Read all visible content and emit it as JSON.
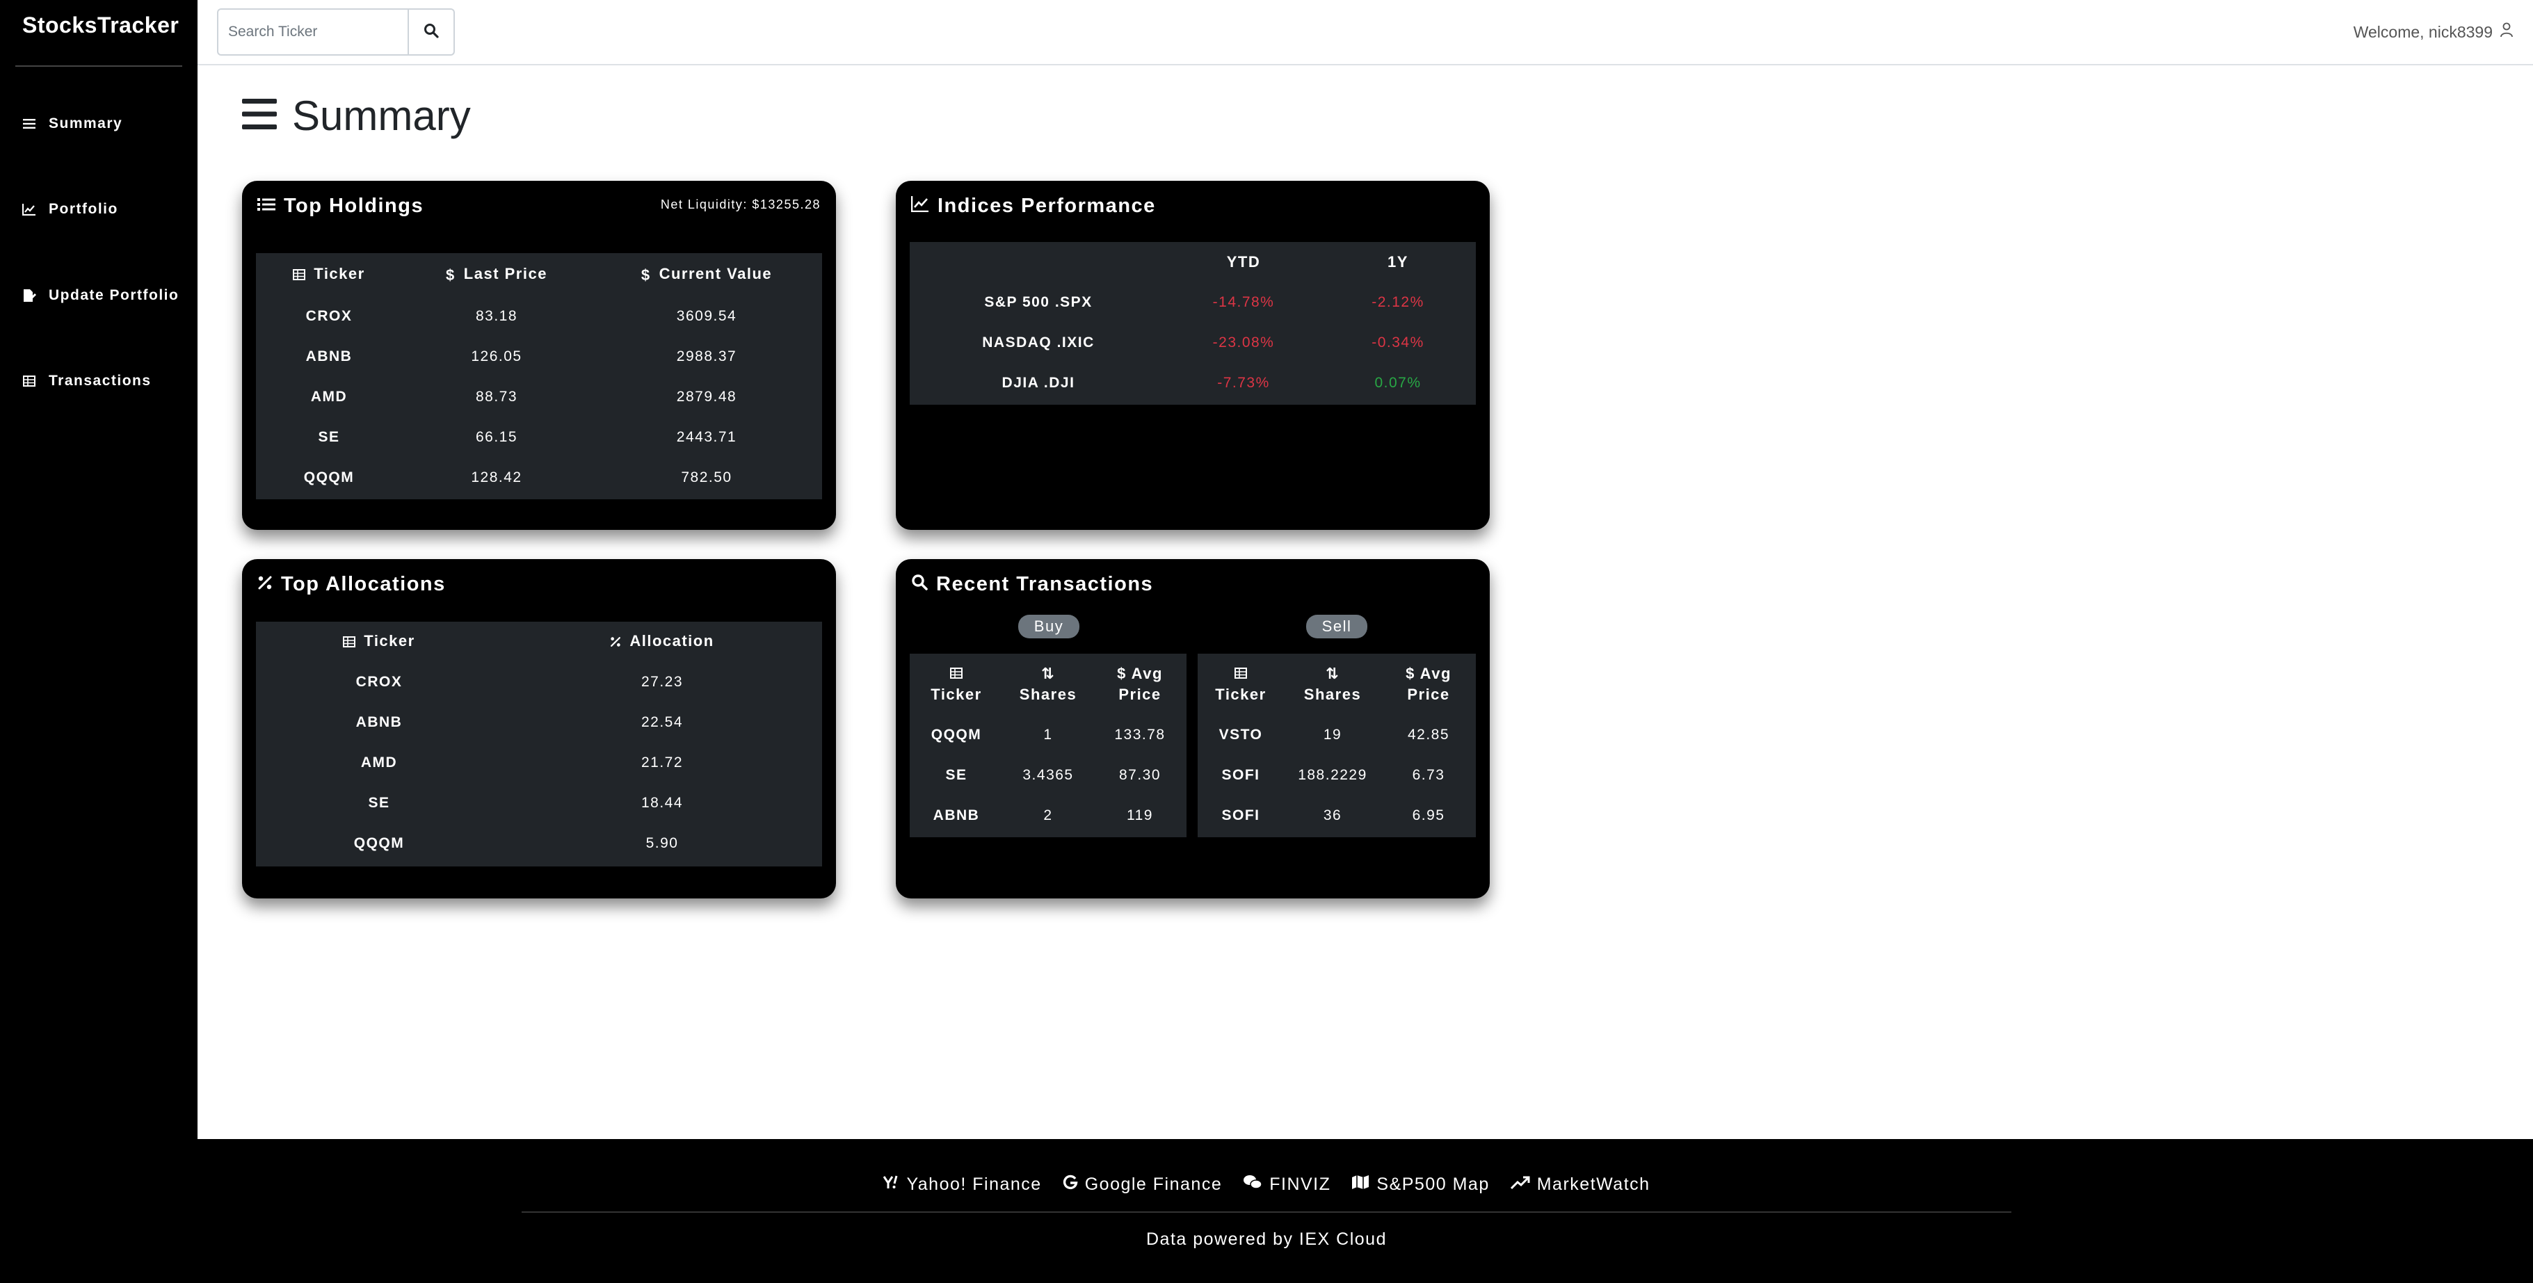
{
  "app": {
    "brand": "StocksTracker"
  },
  "sidebar": {
    "items": [
      {
        "label": "Summary",
        "icon": "list-icon"
      },
      {
        "label": "Portfolio",
        "icon": "chart-line-icon"
      },
      {
        "label": "Update Portfolio",
        "icon": "file-signature-icon"
      },
      {
        "label": "Transactions",
        "icon": "table-icon"
      }
    ]
  },
  "topbar": {
    "search_placeholder": "Search Ticker",
    "welcome": "Welcome, nick8399"
  },
  "page": {
    "title": "Summary"
  },
  "top_holdings": {
    "title": "Top Holdings",
    "net_liquidity": "Net Liquidity: $13255.28",
    "columns": [
      "Ticker",
      "Last Price",
      "Current Value"
    ],
    "rows": [
      [
        "CROX",
        "83.18",
        "3609.54"
      ],
      [
        "ABNB",
        "126.05",
        "2988.37"
      ],
      [
        "AMD",
        "88.73",
        "2879.48"
      ],
      [
        "SE",
        "66.15",
        "2443.71"
      ],
      [
        "QQQM",
        "128.42",
        "782.50"
      ]
    ]
  },
  "indices": {
    "title": "Indices Performance",
    "columns": [
      "",
      "YTD",
      "1Y"
    ],
    "rows": [
      [
        "S&P 500 .SPX",
        "-14.78%",
        "-2.12%"
      ],
      [
        "NASDAQ .IXIC",
        "-23.08%",
        "-0.34%"
      ],
      [
        "DJIA .DJI",
        "-7.73%",
        "0.07%"
      ]
    ],
    "colors": {
      "negative": "#dc3545",
      "positive": "#28a745"
    }
  },
  "top_allocations": {
    "title": "Top Allocations",
    "columns": [
      "Ticker",
      "Allocation"
    ],
    "rows": [
      [
        "CROX",
        "27.23"
      ],
      [
        "ABNB",
        "22.54"
      ],
      [
        "AMD",
        "21.72"
      ],
      [
        "SE",
        "18.44"
      ],
      [
        "QQQM",
        "5.90"
      ]
    ]
  },
  "recent_transactions": {
    "title": "Recent Transactions",
    "buy": {
      "label": "Buy",
      "columns": [
        [
          "Ticker"
        ],
        [
          "Shares"
        ],
        [
          "Avg",
          "Price"
        ]
      ],
      "rows": [
        [
          "QQQM",
          "1",
          "133.78"
        ],
        [
          "SE",
          "3.4365",
          "87.30"
        ],
        [
          "ABNB",
          "2",
          "119"
        ]
      ]
    },
    "sell": {
      "label": "Sell",
      "columns": [
        [
          "Ticker"
        ],
        [
          "Shares"
        ],
        [
          "Avg",
          "Price"
        ]
      ],
      "rows": [
        [
          "VSTO",
          "19",
          "42.85"
        ],
        [
          "SOFI",
          "188.2229",
          "6.73"
        ],
        [
          "SOFI",
          "36",
          "6.95"
        ]
      ]
    }
  },
  "footer": {
    "links": [
      {
        "label": "Yahoo! Finance",
        "icon": "yahoo-icon"
      },
      {
        "label": "Google Finance",
        "icon": "google-icon"
      },
      {
        "label": "FINVIZ",
        "icon": "chat-icon"
      },
      {
        "label": "S&P500 Map",
        "icon": "map-icon"
      },
      {
        "label": "MarketWatch",
        "icon": "trend-up-icon"
      }
    ],
    "powered_by": "Data powered by IEX Cloud"
  }
}
